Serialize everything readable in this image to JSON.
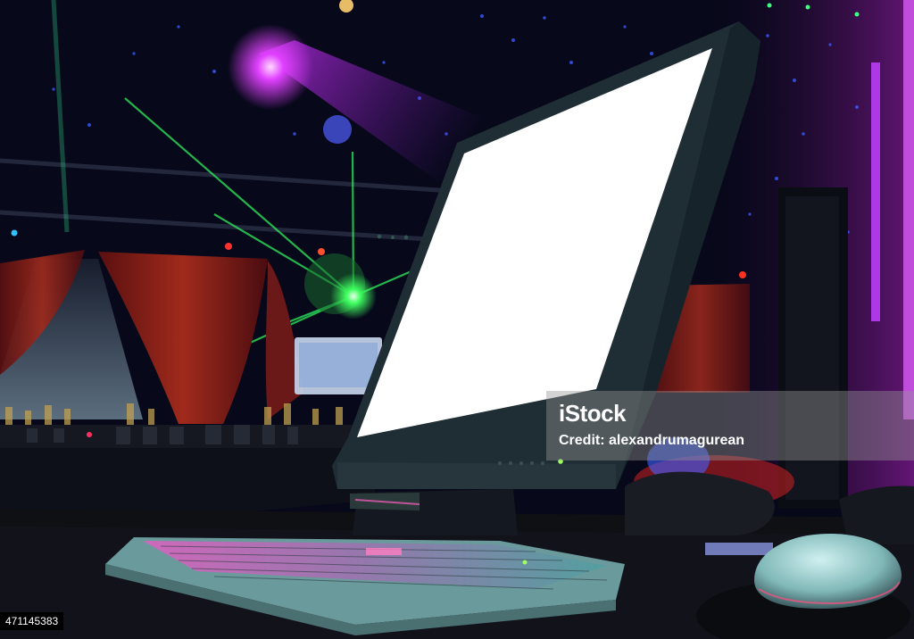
{
  "watermark": {
    "logo_text": "iStock",
    "credit_text": "Credit: alexandrumagurean"
  },
  "stock_id": "471145383",
  "colors": {
    "background": "#07081a",
    "magenta_light": "#e040ff",
    "green_laser": "#40ff60",
    "monitor_screen": "#ffffff",
    "monitor_bezel": "#1f2e34",
    "keyboard": "#7fb0b0"
  },
  "icons": [
    "magenta-spotlight",
    "green-laser",
    "computer-mouse"
  ]
}
